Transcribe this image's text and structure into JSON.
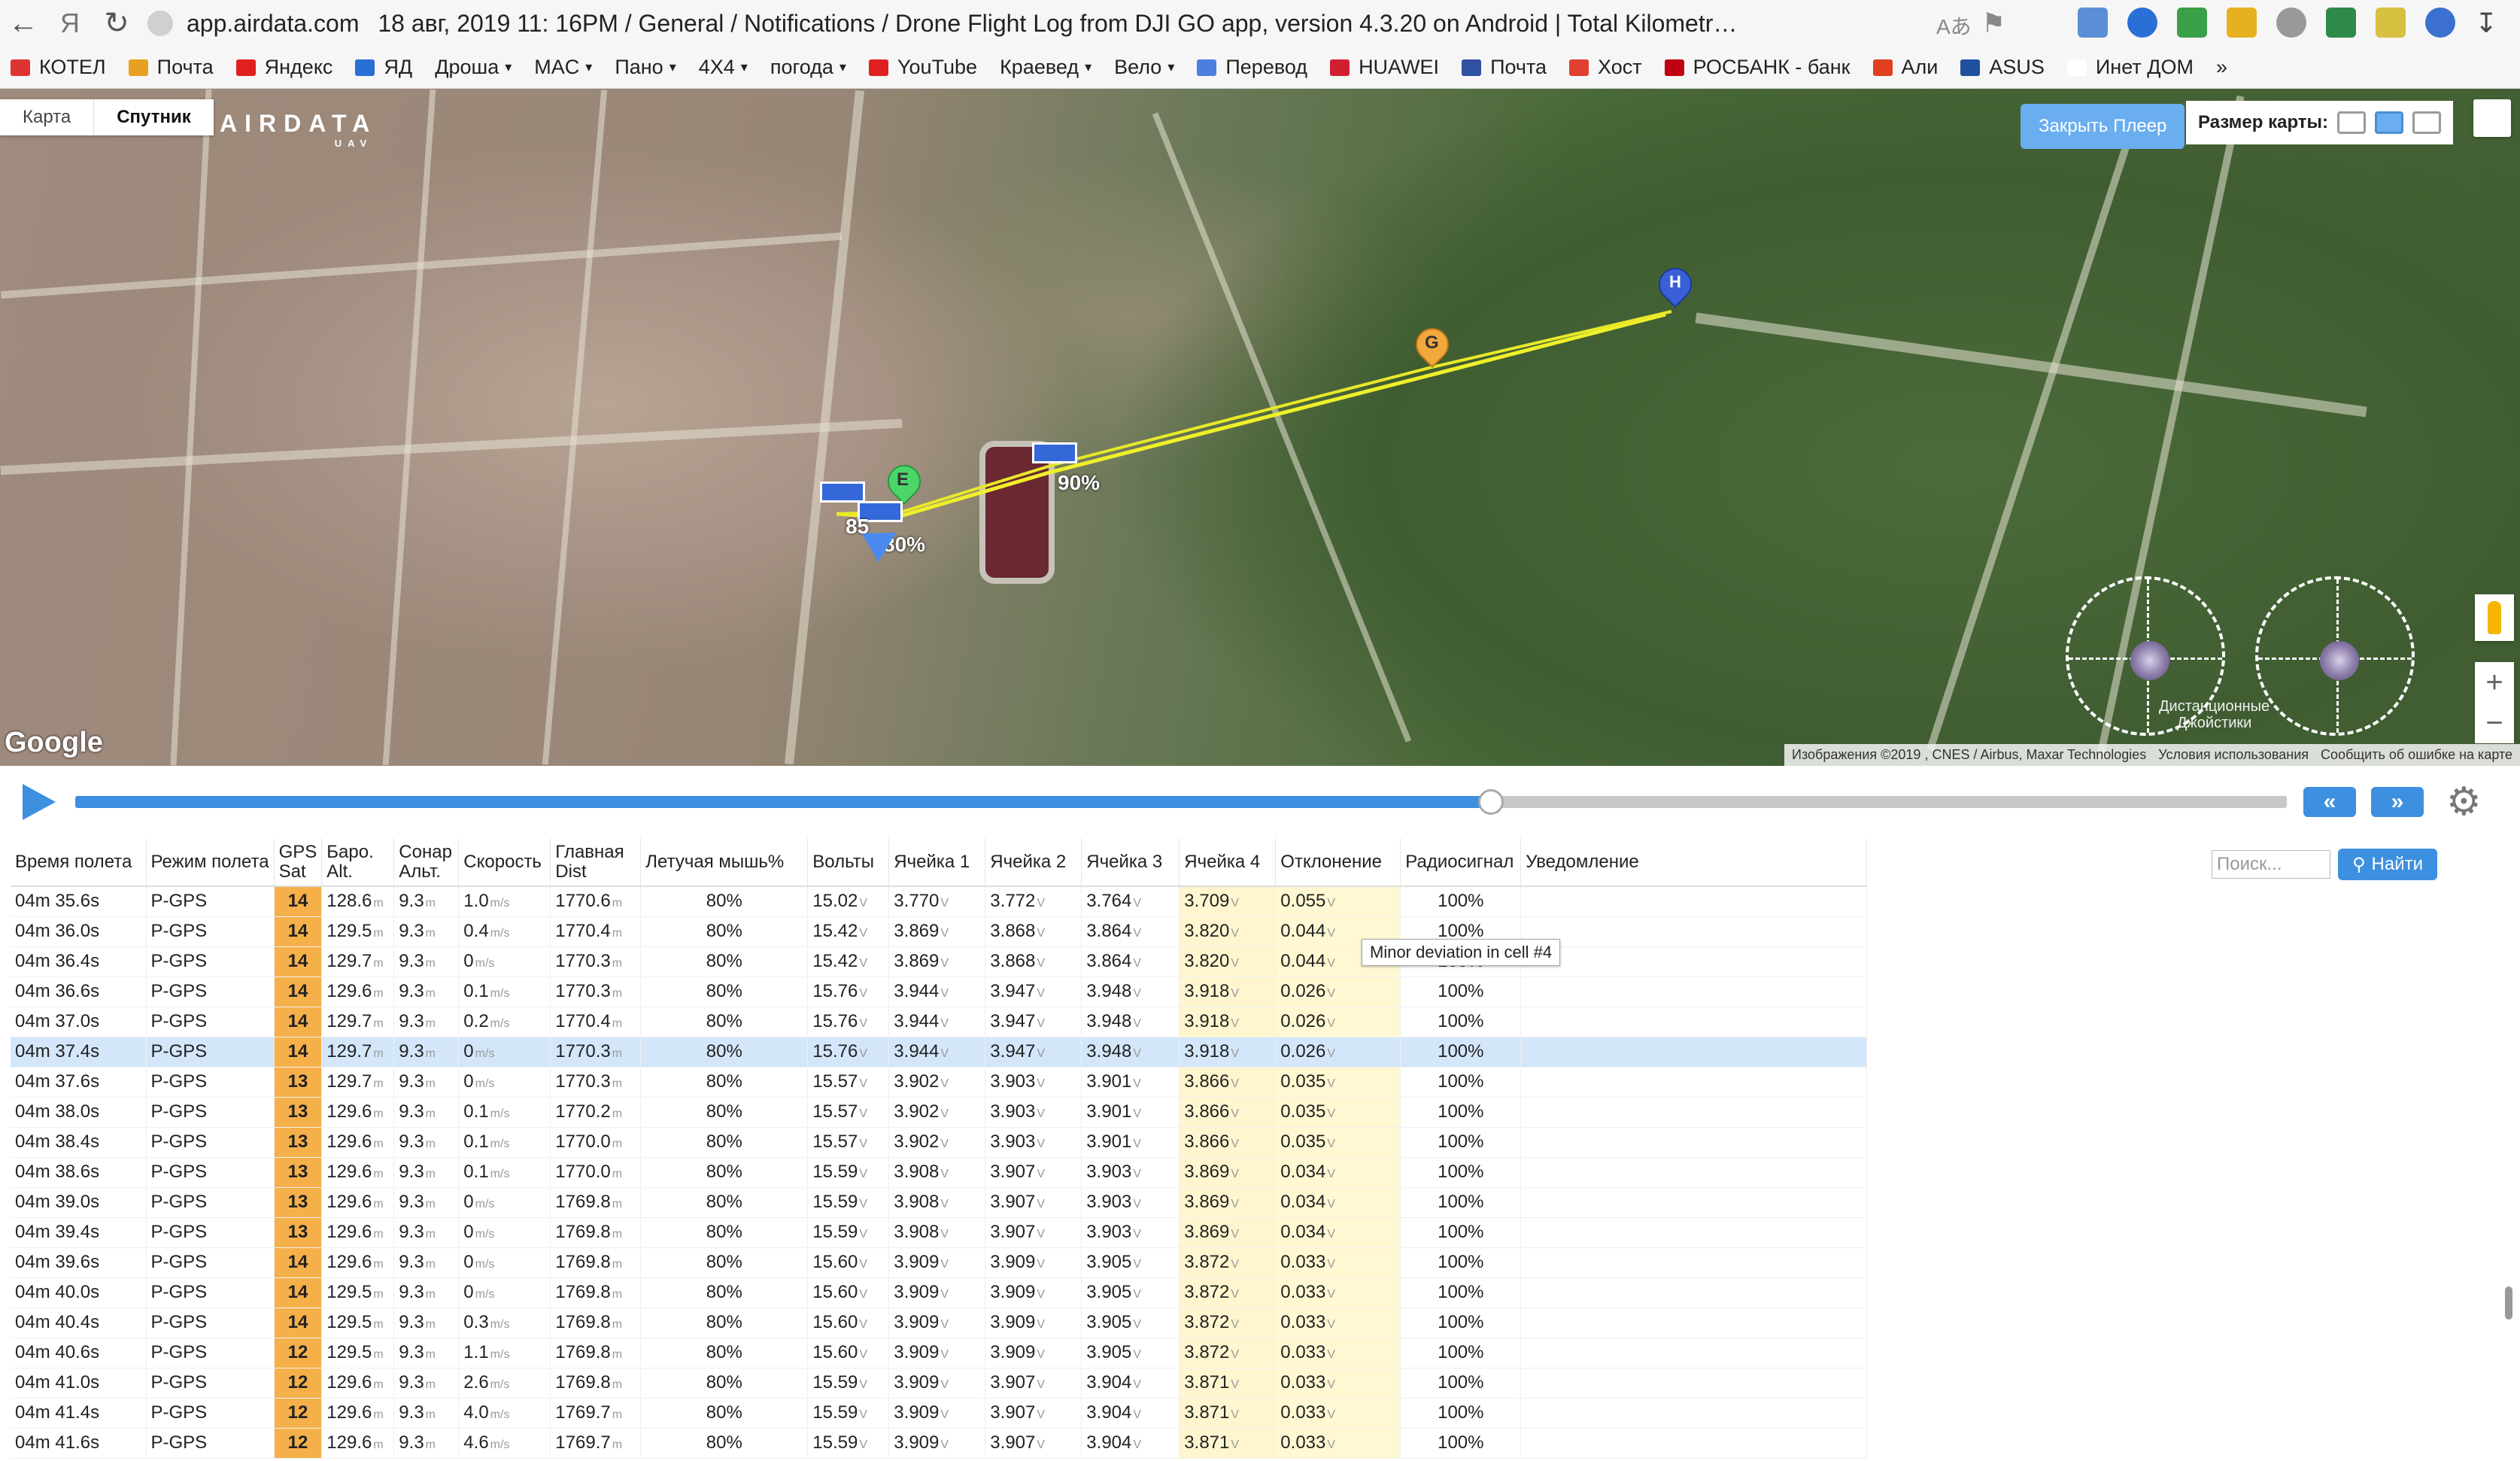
{
  "browser": {
    "host": "app.airdata.com",
    "tab_title": "18 авг, 2019 11: 16PM / General / Notifications / Drone Flight Log from DJI GO app, version 4.3.20 on Android | Total Kilometr…",
    "bookmarks": [
      {
        "label": "КОТЕЛ",
        "color": "#d33",
        "dropdown": false
      },
      {
        "label": "Почта",
        "color": "#e8a020",
        "dropdown": false
      },
      {
        "label": "Яндекс",
        "color": "#e02020",
        "dropdown": false
      },
      {
        "label": "ЯД",
        "color": "#2a6fd6",
        "dropdown": false
      },
      {
        "label": "Дроша",
        "color": "",
        "dropdown": true
      },
      {
        "label": "MAC",
        "color": "",
        "dropdown": true
      },
      {
        "label": "Пано",
        "color": "",
        "dropdown": true
      },
      {
        "label": "4X4",
        "color": "",
        "dropdown": true
      },
      {
        "label": "погода",
        "color": "",
        "dropdown": true
      },
      {
        "label": "YouTube",
        "color": "#e02020",
        "dropdown": false
      },
      {
        "label": "Краевед",
        "color": "",
        "dropdown": true
      },
      {
        "label": "Вело",
        "color": "",
        "dropdown": true
      },
      {
        "label": "Перевод",
        "color": "#4a7fe0",
        "dropdown": false
      },
      {
        "label": "HUAWEI",
        "color": "#d02030",
        "dropdown": false
      },
      {
        "label": "Почта",
        "color": "#3050a0",
        "dropdown": false
      },
      {
        "label": "Хост",
        "color": "#e04030",
        "dropdown": false
      },
      {
        "label": "РОСБАНК - банк",
        "color": "#c00010",
        "dropdown": false
      },
      {
        "label": "Али",
        "color": "#e04020",
        "dropdown": false
      },
      {
        "label": "ASUS",
        "color": "#2050a0",
        "dropdown": false
      },
      {
        "label": "Инет ДОМ",
        "color": "#ffffff",
        "dropdown": false
      }
    ]
  },
  "map": {
    "type_buttons": [
      "Карта",
      "Спутник"
    ],
    "logo": "AIRDATA",
    "logo_sub": "UAV",
    "close_player": "Закрыть Плеер",
    "map_size_label": "Размер карты:",
    "google": "Google",
    "attribution": "Изображения ©2019 , CNES / Airbus, Maxar Technologies",
    "terms": "Условия использования",
    "report": "Сообщить об ошибке на карте",
    "joystick_label_1": "Дистанционные",
    "joystick_label_2": "Джойстики",
    "markers": {
      "home": "H",
      "g": "G",
      "e": "E",
      "battery_labels": [
        "90%",
        "85",
        "80%"
      ]
    }
  },
  "player": {
    "progress": 0.64
  },
  "table": {
    "headers": [
      "Время полета",
      "Режим полета",
      "GPS Sat",
      "Баро. Alt.",
      "Сонар Альт.",
      "Скорость",
      "Главная Dist",
      "Летучая мышь%",
      "Вольты",
      "Ячейка 1",
      "Ячейка 2",
      "Ячейка 3",
      "Ячейка 4",
      "Отклонение",
      "Радиосигнал",
      "Уведомление"
    ],
    "search_placeholder": "Поиск...",
    "search_button": "Найти",
    "tooltip": "Minor deviation in cell #4",
    "selected_row": 5,
    "rows": [
      [
        "04m 35.6s",
        "P-GPS",
        "14",
        "128.6",
        "9.3",
        "1.0",
        "1770.6",
        "80%",
        "15.02",
        "3.770",
        "3.772",
        "3.764",
        "3.709",
        "0.055",
        "100%"
      ],
      [
        "04m 36.0s",
        "P-GPS",
        "14",
        "129.5",
        "9.3",
        "0.4",
        "1770.4",
        "80%",
        "15.42",
        "3.869",
        "3.868",
        "3.864",
        "3.820",
        "0.044",
        "100%"
      ],
      [
        "04m 36.4s",
        "P-GPS",
        "14",
        "129.7",
        "9.3",
        "0",
        "1770.3",
        "80%",
        "15.42",
        "3.869",
        "3.868",
        "3.864",
        "3.820",
        "0.044",
        "100%"
      ],
      [
        "04m 36.6s",
        "P-GPS",
        "14",
        "129.6",
        "9.3",
        "0.1",
        "1770.3",
        "80%",
        "15.76",
        "3.944",
        "3.947",
        "3.948",
        "3.918",
        "0.026",
        "100%"
      ],
      [
        "04m 37.0s",
        "P-GPS",
        "14",
        "129.7",
        "9.3",
        "0.2",
        "1770.4",
        "80%",
        "15.76",
        "3.944",
        "3.947",
        "3.948",
        "3.918",
        "0.026",
        "100%"
      ],
      [
        "04m 37.4s",
        "P-GPS",
        "14",
        "129.7",
        "9.3",
        "0",
        "1770.3",
        "80%",
        "15.76",
        "3.944",
        "3.947",
        "3.948",
        "3.918",
        "0.026",
        "100%"
      ],
      [
        "04m 37.6s",
        "P-GPS",
        "13",
        "129.7",
        "9.3",
        "0",
        "1770.3",
        "80%",
        "15.57",
        "3.902",
        "3.903",
        "3.901",
        "3.866",
        "0.035",
        "100%"
      ],
      [
        "04m 38.0s",
        "P-GPS",
        "13",
        "129.6",
        "9.3",
        "0.1",
        "1770.2",
        "80%",
        "15.57",
        "3.902",
        "3.903",
        "3.901",
        "3.866",
        "0.035",
        "100%"
      ],
      [
        "04m 38.4s",
        "P-GPS",
        "13",
        "129.6",
        "9.3",
        "0.1",
        "1770.0",
        "80%",
        "15.57",
        "3.902",
        "3.903",
        "3.901",
        "3.866",
        "0.035",
        "100%"
      ],
      [
        "04m 38.6s",
        "P-GPS",
        "13",
        "129.6",
        "9.3",
        "0.1",
        "1770.0",
        "80%",
        "15.59",
        "3.908",
        "3.907",
        "3.903",
        "3.869",
        "0.034",
        "100%"
      ],
      [
        "04m 39.0s",
        "P-GPS",
        "13",
        "129.6",
        "9.3",
        "0",
        "1769.8",
        "80%",
        "15.59",
        "3.908",
        "3.907",
        "3.903",
        "3.869",
        "0.034",
        "100%"
      ],
      [
        "04m 39.4s",
        "P-GPS",
        "13",
        "129.6",
        "9.3",
        "0",
        "1769.8",
        "80%",
        "15.59",
        "3.908",
        "3.907",
        "3.903",
        "3.869",
        "0.034",
        "100%"
      ],
      [
        "04m 39.6s",
        "P-GPS",
        "14",
        "129.6",
        "9.3",
        "0",
        "1769.8",
        "80%",
        "15.60",
        "3.909",
        "3.909",
        "3.905",
        "3.872",
        "0.033",
        "100%"
      ],
      [
        "04m 40.0s",
        "P-GPS",
        "14",
        "129.5",
        "9.3",
        "0",
        "1769.8",
        "80%",
        "15.60",
        "3.909",
        "3.909",
        "3.905",
        "3.872",
        "0.033",
        "100%"
      ],
      [
        "04m 40.4s",
        "P-GPS",
        "14",
        "129.5",
        "9.3",
        "0.3",
        "1769.8",
        "80%",
        "15.60",
        "3.909",
        "3.909",
        "3.905",
        "3.872",
        "0.033",
        "100%"
      ],
      [
        "04m 40.6s",
        "P-GPS",
        "12",
        "129.5",
        "9.3",
        "1.1",
        "1769.8",
        "80%",
        "15.60",
        "3.909",
        "3.909",
        "3.905",
        "3.872",
        "0.033",
        "100%"
      ],
      [
        "04m 41.0s",
        "P-GPS",
        "12",
        "129.6",
        "9.3",
        "2.6",
        "1769.8",
        "80%",
        "15.59",
        "3.909",
        "3.907",
        "3.904",
        "3.871",
        "0.033",
        "100%"
      ],
      [
        "04m 41.4s",
        "P-GPS",
        "12",
        "129.6",
        "9.3",
        "4.0",
        "1769.7",
        "80%",
        "15.59",
        "3.909",
        "3.907",
        "3.904",
        "3.871",
        "0.033",
        "100%"
      ],
      [
        "04m 41.6s",
        "P-GPS",
        "12",
        "129.6",
        "9.3",
        "4.6",
        "1769.7",
        "80%",
        "15.59",
        "3.909",
        "3.907",
        "3.904",
        "3.871",
        "0.033",
        "100%"
      ]
    ],
    "units": {
      "alt": "m",
      "speed": "m/s",
      "dist": "m",
      "volt": "V"
    }
  }
}
